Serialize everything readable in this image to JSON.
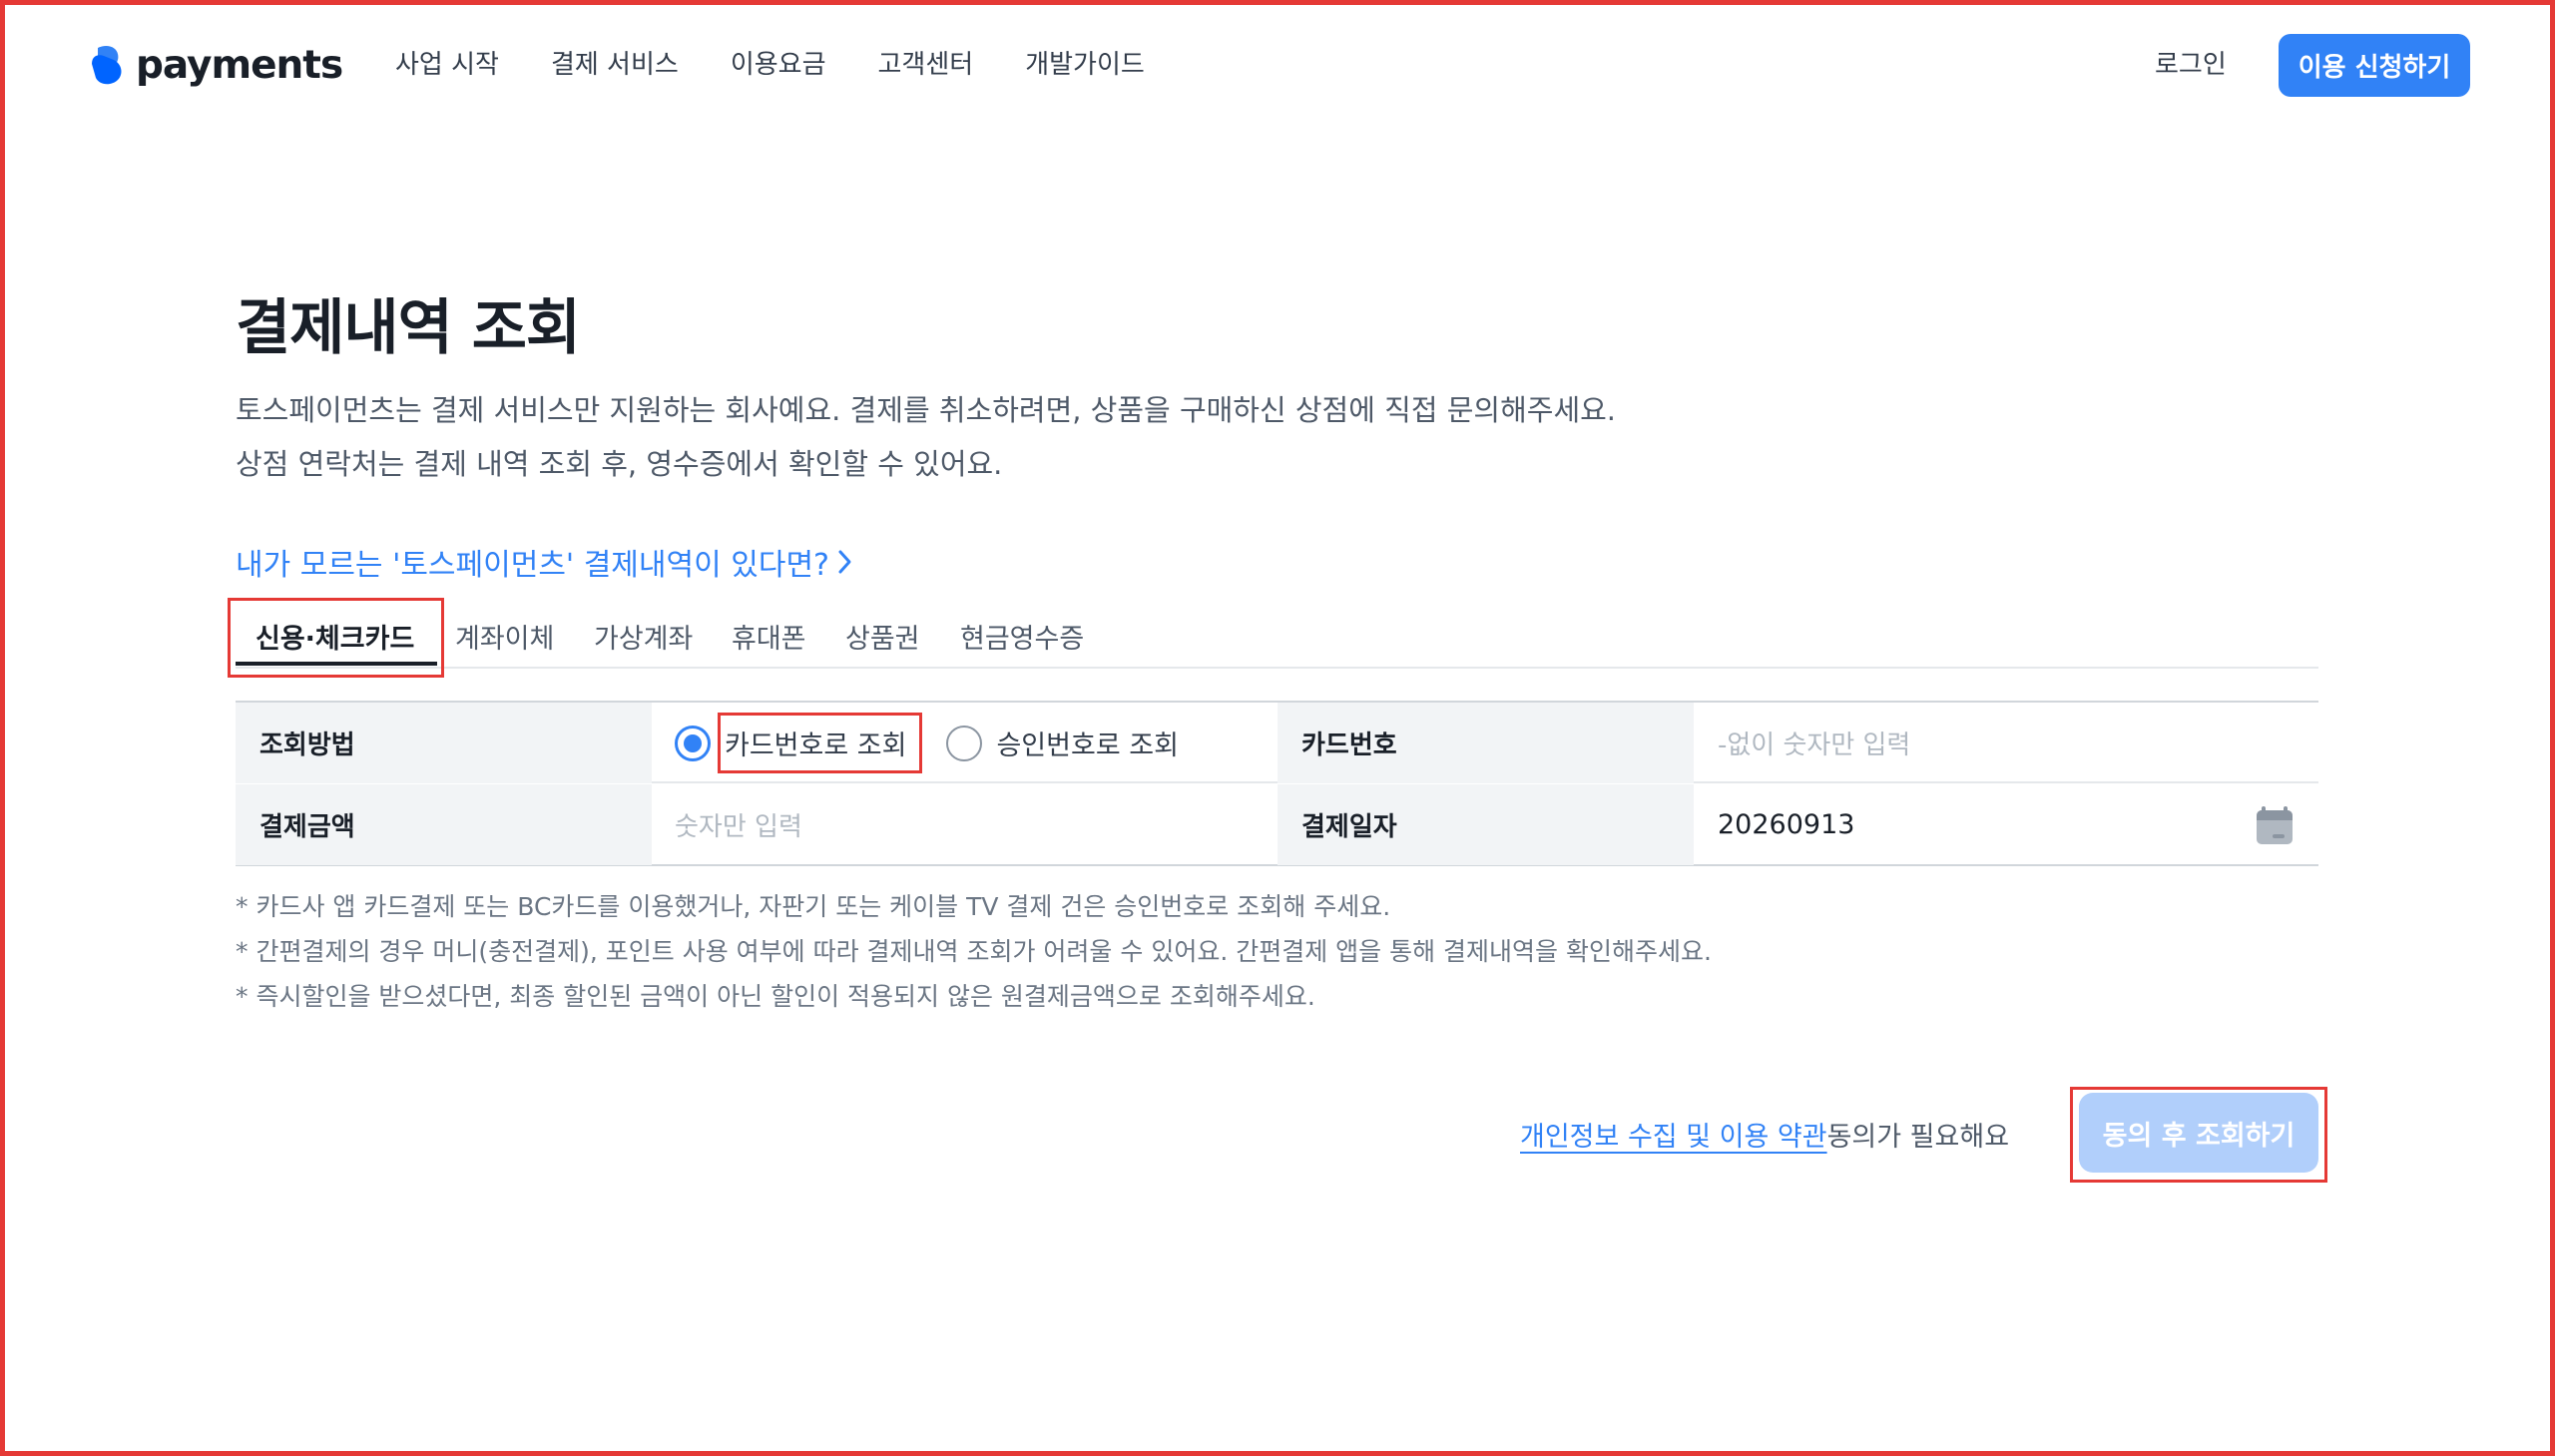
{
  "header": {
    "logo_text": "payments",
    "nav": [
      "사업 시작",
      "결제 서비스",
      "이용요금",
      "고객센터",
      "개발가이드"
    ],
    "login_label": "로그인",
    "apply_label": "이용 신청하기"
  },
  "page": {
    "title": "결제내역 조회",
    "desc_line1": "토스페이먼츠는 결제 서비스만 지원하는 회사예요. 결제를 취소하려면, 상품을 구매하신 상점에 직접 문의해주세요.",
    "desc_line2": "상점 연락처는 결제 내역 조회 후, 영수증에서 확인할 수 있어요.",
    "unknown_link": "내가 모르는 '토스페이먼츠' 결제내역이 있다면?"
  },
  "tabs": [
    "신용·체크카드",
    "계좌이체",
    "가상계좌",
    "휴대폰",
    "상품권",
    "현금영수증"
  ],
  "active_tab": "신용·체크카드",
  "form": {
    "method_label": "조회방법",
    "radio_card": "카드번호로 조회",
    "radio_approval": "승인번호로 조회",
    "selected_method": "카드번호로 조회",
    "card_label": "카드번호",
    "card_placeholder": "-없이 숫자만 입력",
    "amount_label": "결제금액",
    "amount_placeholder": "숫자만 입력",
    "date_label": "결제일자",
    "date_value": "20260913"
  },
  "notes": [
    "* 카드사 앱 카드결제 또는 BC카드를 이용했거나, 자판기 또는 케이블 TV 결제 건은 승인번호로 조회해 주세요.",
    "* 간편결제의 경우 머니(충전결제), 포인트 사용 여부에 따라 결제내역 조회가 어려울 수 있어요. 간편결제 앱을 통해 결제내역을 확인해주세요.",
    "* 즉시할인을 받으셨다면, 최종 할인된 금액이 아닌 할인이 적용되지 않은 원결제금액으로 조회해주세요."
  ],
  "agreement": {
    "link_text": "개인정보 수집 및 이용 약관",
    "suffix": "동의가 필요해요"
  },
  "query_button": "동의 후 조회하기",
  "icons": {
    "logo": "toss-logo-icon",
    "chevron": "chevron-right-icon",
    "calendar": "calendar-icon"
  },
  "colors": {
    "brand": "#3182f6",
    "disabled_button": "#b1cffb",
    "highlight": "#e53935"
  }
}
